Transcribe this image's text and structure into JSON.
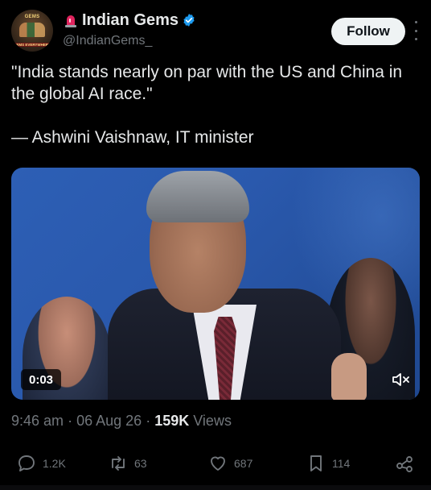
{
  "author": {
    "display_name": "Indian Gems",
    "handle": "@IndianGems_",
    "avatar_text_top": "GEMS",
    "avatar_text_bottom": "GEMS EVERYWHERE"
  },
  "follow_label": "Follow",
  "tweet": {
    "quote": "\"India stands nearly on par with the US and China in the global AI race.\"",
    "attribution": "— Ashwini Vaishnaw, IT minister"
  },
  "media": {
    "duration": "0:03",
    "muted": true
  },
  "meta": {
    "time": "9:46 am",
    "date": "06 Aug 26",
    "views_count": "159K",
    "views_label": "Views",
    "separator": "·"
  },
  "actions": {
    "replies": "1.2K",
    "reposts": "63",
    "likes": "687",
    "bookmarks": "114"
  },
  "colors": {
    "background": "#000000",
    "text": "#e7e9ea",
    "muted": "#71767b",
    "verified": "#1d9bf0",
    "siren": "#e0245e"
  },
  "icons": {
    "verified": "verified-badge-icon",
    "siren": "police-light-emoji-icon",
    "more": "more-vertical-icon",
    "mute": "volume-muted-icon",
    "reply": "reply-bubble-icon",
    "repost": "repost-arrows-icon",
    "like": "heart-icon",
    "bookmark": "bookmark-icon",
    "share": "share-icon"
  }
}
